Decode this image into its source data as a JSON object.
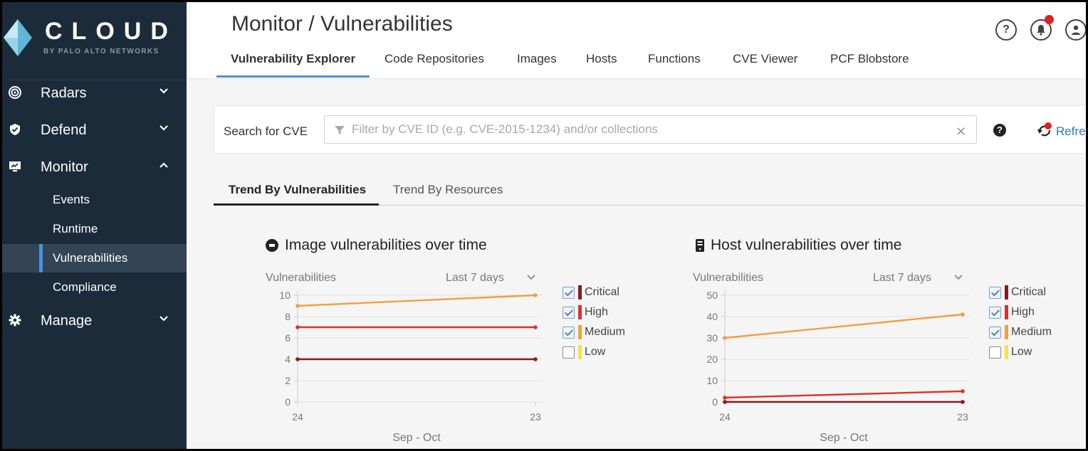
{
  "brand": {
    "name": "CLOUD",
    "subtitle": "BY PALO ALTO NETWORKS"
  },
  "sidebar": {
    "items": [
      {
        "label": "Radars",
        "icon": "radar-icon",
        "expanded": false
      },
      {
        "label": "Defend",
        "icon": "shield-icon",
        "expanded": false
      },
      {
        "label": "Monitor",
        "icon": "monitor-icon",
        "expanded": true,
        "children": [
          {
            "label": "Events"
          },
          {
            "label": "Runtime"
          },
          {
            "label": "Vulnerabilities",
            "active": true
          },
          {
            "label": "Compliance"
          }
        ]
      },
      {
        "label": "Manage",
        "icon": "gear-icon",
        "expanded": false
      }
    ]
  },
  "header": {
    "title": "Monitor / Vulnerabilities",
    "tabs": [
      {
        "label": "Vulnerability Explorer",
        "active": true
      },
      {
        "label": "Code Repositories"
      },
      {
        "label": "Images"
      },
      {
        "label": "Hosts"
      },
      {
        "label": "Functions"
      },
      {
        "label": "CVE Viewer"
      },
      {
        "label": "PCF Blobstore"
      }
    ],
    "icons": [
      "help-icon",
      "notification-bell-icon",
      "user-avatar-icon"
    ]
  },
  "search": {
    "label": "Search for CVE",
    "placeholder": "Filter by CVE ID (e.g. CVE-2015-1234) and/or collections",
    "value": "",
    "refresh_label": "Refre"
  },
  "subtabs": [
    {
      "label": "Trend By Vulnerabilities",
      "active": true
    },
    {
      "label": "Trend By Resources"
    }
  ],
  "colors": {
    "critical": "#8b1a1a",
    "high": "#d9342b",
    "medium": "#f0a040",
    "low": "#f2e34a",
    "accent": "#4a90e2",
    "sidebar": "#1c2b3a"
  },
  "chart_data": [
    {
      "type": "line",
      "title": "Image vulnerabilities over time",
      "ylabel": "Vulnerabilities",
      "xlabel": "Sep - Oct",
      "range": "Last 7 days",
      "x": [
        "24",
        "23"
      ],
      "ylim": [
        0,
        10
      ],
      "yticks": [
        0,
        2,
        4,
        6,
        8,
        10
      ],
      "series": [
        {
          "name": "Critical",
          "color": "#8b1a1a",
          "checked": true,
          "values": [
            4,
            4
          ]
        },
        {
          "name": "High",
          "color": "#d9342b",
          "checked": true,
          "values": [
            7,
            7
          ]
        },
        {
          "name": "Medium",
          "color": "#f0a040",
          "checked": true,
          "values": [
            9,
            10
          ]
        },
        {
          "name": "Low",
          "color": "#f2e34a",
          "checked": false,
          "values": []
        }
      ]
    },
    {
      "type": "line",
      "title": "Host vulnerabilities over time",
      "ylabel": "Vulnerabilities",
      "xlabel": "Sep - Oct",
      "range": "Last 7 days",
      "x": [
        "24",
        "23"
      ],
      "ylim": [
        0,
        50
      ],
      "yticks": [
        0,
        10,
        20,
        30,
        40,
        50
      ],
      "series": [
        {
          "name": "Critical",
          "color": "#8b1a1a",
          "checked": true,
          "values": [
            0,
            0
          ]
        },
        {
          "name": "High",
          "color": "#d9342b",
          "checked": true,
          "values": [
            2,
            5
          ]
        },
        {
          "name": "Medium",
          "color": "#f0a040",
          "checked": true,
          "values": [
            30,
            41
          ]
        },
        {
          "name": "Low",
          "color": "#f2e34a",
          "checked": false,
          "values": []
        }
      ]
    }
  ]
}
